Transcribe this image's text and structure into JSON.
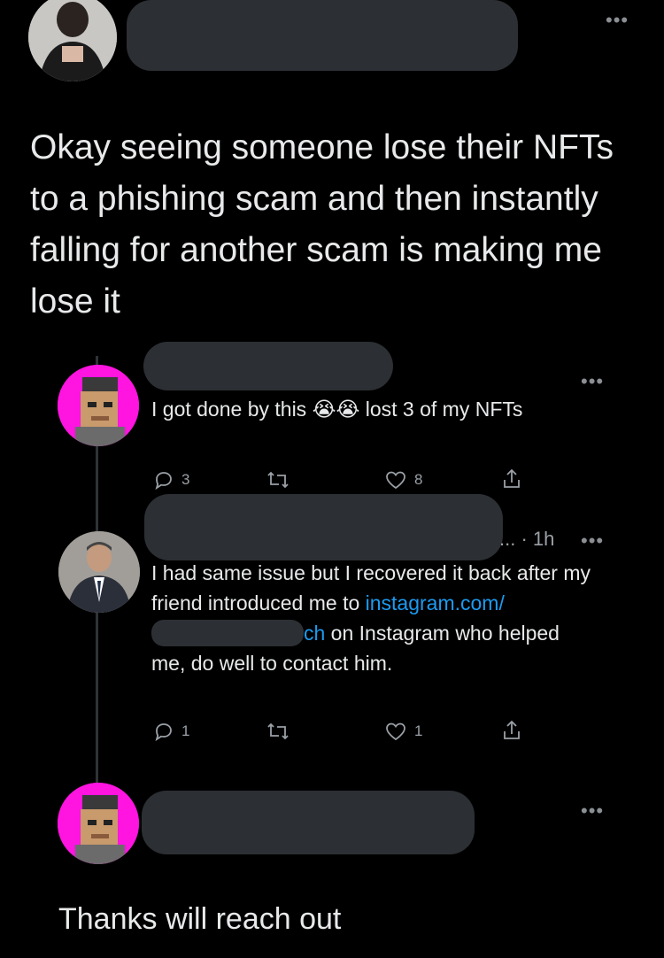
{
  "tweet": {
    "more": "•••",
    "text": "Okay seeing someone lose their NFTs to a phishing scam and then instantly falling for another scam is making me lose it"
  },
  "reply1": {
    "more": "•••",
    "text_a": "I got done by this",
    "emoji": "😭😭",
    "text_b": " lost 3 of my NFTs",
    "replies": "3",
    "likes": "8"
  },
  "reply2": {
    "more": "•••",
    "meta": "... · 1h",
    "text_a": "I had same issue  but I recovered it back after my friend introduced me to ",
    "link_a": "instagram.com/",
    "link_b": "ch",
    "text_b": " on Instagram who helped me, do well to contact him.",
    "replies": "1",
    "likes": "1"
  },
  "reply3": {
    "more": "•••",
    "text": "Thanks will reach out"
  },
  "icons": [
    "reply-icon",
    "retweet-icon",
    "like-icon",
    "share-icon",
    "more-icon"
  ]
}
